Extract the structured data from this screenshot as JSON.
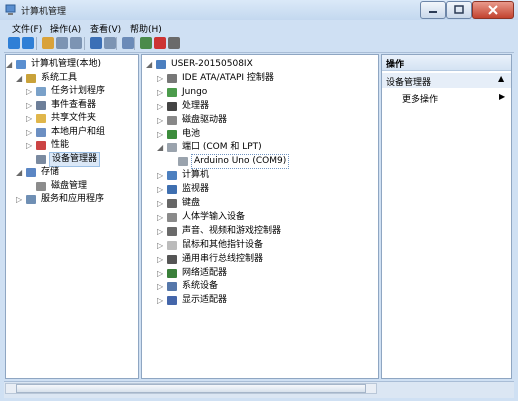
{
  "window": {
    "title": "计算机管理"
  },
  "menubar": [
    "文件(F)",
    "操作(A)",
    "查看(V)",
    "帮助(H)"
  ],
  "toolbar": [
    "back-icon",
    "forward-icon",
    "up-icon",
    "show-hide-tree-icon",
    "properties-icon",
    "help-icon",
    "details-icon",
    "scan-icon",
    "update-driver-icon",
    "uninstall-icon",
    "disable-icon"
  ],
  "left_tree": [
    {
      "label": "计算机管理(本地)",
      "icon": "computer-management-icon",
      "level": 0,
      "expand": "expanded"
    },
    {
      "label": "系统工具",
      "icon": "tools-icon",
      "level": 1,
      "expand": "expanded"
    },
    {
      "label": "任务计划程序",
      "icon": "clock-icon",
      "level": 2,
      "expand": "collapsed"
    },
    {
      "label": "事件查看器",
      "icon": "event-viewer-icon",
      "level": 2,
      "expand": "collapsed"
    },
    {
      "label": "共享文件夹",
      "icon": "shared-folder-icon",
      "level": 2,
      "expand": "collapsed"
    },
    {
      "label": "本地用户和组",
      "icon": "users-icon",
      "level": 2,
      "expand": "collapsed"
    },
    {
      "label": "性能",
      "icon": "performance-icon",
      "level": 2,
      "expand": "collapsed"
    },
    {
      "label": "设备管理器",
      "icon": "device-manager-icon",
      "level": 2,
      "expand": "none",
      "selected": true
    },
    {
      "label": "存储",
      "icon": "storage-icon",
      "level": 1,
      "expand": "expanded"
    },
    {
      "label": "磁盘管理",
      "icon": "disk-management-icon",
      "level": 2,
      "expand": "none"
    },
    {
      "label": "服务和应用程序",
      "icon": "services-icon",
      "level": 1,
      "expand": "collapsed"
    }
  ],
  "device_tree": [
    {
      "label": "USER-20150508IX",
      "icon": "computer-icon",
      "level": 0,
      "expand": "expanded"
    },
    {
      "label": "IDE ATA/ATAPI 控制器",
      "icon": "ide-controller-icon",
      "level": 1,
      "expand": "collapsed"
    },
    {
      "label": "Jungo",
      "icon": "jungo-icon",
      "level": 1,
      "expand": "collapsed"
    },
    {
      "label": "处理器",
      "icon": "processor-icon",
      "level": 1,
      "expand": "collapsed"
    },
    {
      "label": "磁盘驱动器",
      "icon": "disk-drive-icon",
      "level": 1,
      "expand": "collapsed"
    },
    {
      "label": "电池",
      "icon": "battery-icon",
      "level": 1,
      "expand": "collapsed"
    },
    {
      "label": "端口 (COM 和 LPT)",
      "icon": "port-icon",
      "level": 1,
      "expand": "expanded"
    },
    {
      "label": "Arduino Uno (COM9)",
      "icon": "port-icon",
      "level": 2,
      "expand": "none",
      "focused": true
    },
    {
      "label": "计算机",
      "icon": "computer-icon",
      "level": 1,
      "expand": "collapsed"
    },
    {
      "label": "监视器",
      "icon": "monitor-icon",
      "level": 1,
      "expand": "collapsed"
    },
    {
      "label": "键盘",
      "icon": "keyboard-icon",
      "level": 1,
      "expand": "collapsed"
    },
    {
      "label": "人体学输入设备",
      "icon": "hid-icon",
      "level": 1,
      "expand": "collapsed"
    },
    {
      "label": "声音、视频和游戏控制器",
      "icon": "sound-icon",
      "level": 1,
      "expand": "collapsed"
    },
    {
      "label": "鼠标和其他指针设备",
      "icon": "mouse-icon",
      "level": 1,
      "expand": "collapsed"
    },
    {
      "label": "通用串行总线控制器",
      "icon": "usb-icon",
      "level": 1,
      "expand": "collapsed"
    },
    {
      "label": "网络适配器",
      "icon": "network-adapter-icon",
      "level": 1,
      "expand": "collapsed"
    },
    {
      "label": "系统设备",
      "icon": "system-device-icon",
      "level": 1,
      "expand": "collapsed"
    },
    {
      "label": "显示适配器",
      "icon": "display-adapter-icon",
      "level": 1,
      "expand": "collapsed"
    }
  ],
  "actions": {
    "header": "操作",
    "section": "设备管理器",
    "more": "更多操作"
  },
  "colors": {
    "accent": "#3a6ea5",
    "selection": "#dbe8f7"
  }
}
